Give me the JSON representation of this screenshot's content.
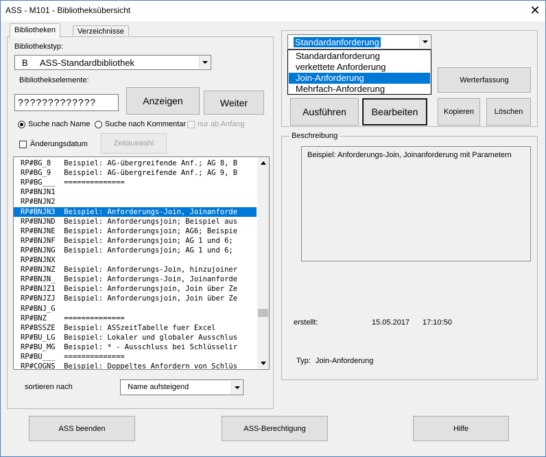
{
  "window": {
    "title": "ASS - M101 - Bibliotheksübersicht",
    "close_glyph": "✕"
  },
  "tabs": [
    {
      "label": "Bibliotheken",
      "active": true
    },
    {
      "label": "Verzeichnisse",
      "active": false
    }
  ],
  "library": {
    "type_label": "Bibliothekstyp:",
    "type_value": "B     ASS-Standardbibliothek",
    "elements_label": "Bibliothekselemente:",
    "search_value": "?????????????",
    "show_button": "Anzeigen",
    "next_button": "Weiter",
    "radio_name": "Suche nach Name",
    "radio_comment": "Suche nach Kommentar",
    "check_start": "nur ab Anfang",
    "check_date": "Änderungsdatum",
    "time_button": "Zeitauswahl",
    "items": [
      "RP#BG_8   Beispiel: AG-übergreifende Anf.; AG 8, B",
      "RP#BG_9   Beispiel: AG-übergreifende Anf.; AG 9, B",
      "RP#BG___  ==============",
      "RP#BNJN1",
      "RP#BNJN2",
      "RP#BNJN3  Beispiel: Anforderungs-Join, Joinanforde",
      "RP#BNJND  Beispiel: Anforderungsjoin; Beispiel aus",
      "RP#BNJNE  Beispiel: Anforderungsjoin; AG6; Beispie",
      "RP#BNJNF  Beispiel: Anforderungsjoin; AG 1 und 6;",
      "RP#BNJNG  Beispiel: Anforderungsjoin; AG 1 und 6;",
      "RP#BNJNX",
      "RP#BNJNZ  Beispiel: Anforderungs-Join, hinzujoiner",
      "RP#BNJN_  Beispiel: Anforderungs-Join, Joinanforde",
      "RP#BNJZ1  Beispiel: Anforderungsjoin, Join über Ze",
      "RP#BNJZJ  Beispiel: Anforderungsjoin, Join über Ze",
      "RP#BNJ_G",
      "RP#BNZ    ==============",
      "RP#BSSZE  Beispiel: ASSzeitTabelle fuer Excel",
      "RP#BU_LG  Beispiel: Lokaler und globaler Ausschlus",
      "RP#BU_MG  Beispiel: * - Ausschluss bei Schlüsselir",
      "RP#BU___  ==============",
      "RP#COGNS  Beispiel: Doppeltes Anfordern von Schlüs"
    ],
    "selected_index": 5,
    "sort_label": "sortieren nach",
    "sort_value": "Name aufsteigend"
  },
  "request": {
    "combo_value": "Standardanforderung",
    "options": [
      "Standardanforderung",
      "verkettete Anforderung",
      "Join-Anforderung",
      "Mehrfach-Anforderung"
    ],
    "selected_option": 2,
    "value_entry_button": "Werterfassung",
    "execute_button": "Ausführen",
    "edit_button": "Bearbeiten",
    "copy_button": "Kopieren",
    "delete_button": "Löschen"
  },
  "description": {
    "group_label": "Beschreibung",
    "text": "Beispiel: Anforderungs-Join, Joinanforderung mit Parametern",
    "created_label": "erstellt:",
    "created_date": "15.05.2017",
    "created_time": "17:10:50",
    "type_label": "Typ:",
    "type_value": "Join-Anforderung"
  },
  "footer": {
    "quit_button": "ASS beenden",
    "auth_button": "ASS-Berechtigung",
    "help_button": "Hilfe"
  }
}
